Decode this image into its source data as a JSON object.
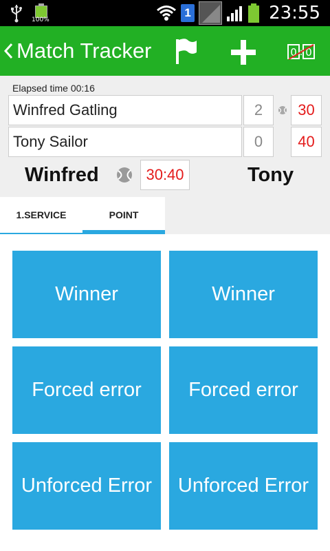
{
  "status_bar": {
    "battery_small_label": "100%",
    "sim_number": "1",
    "time": "23:55"
  },
  "action_bar": {
    "title": "Match Tracker",
    "icons": [
      "back-arrow-icon",
      "flag-icon",
      "plus-icon",
      "score-reset-icon"
    ],
    "score_icon_text": "0:0"
  },
  "match": {
    "elapsed_label": "Elapsed time 00:16",
    "players": [
      {
        "name": "Winfred Gatling",
        "sets": "2",
        "points": "30",
        "serving": true
      },
      {
        "name": "Tony Sailor",
        "sets": "0",
        "points": "40",
        "serving": false
      }
    ],
    "left_short_name": "Winfred",
    "right_short_name": "Tony",
    "game_score": "30:40"
  },
  "tabs": [
    {
      "label": "1.SERVICE",
      "active": false
    },
    {
      "label": "POINT",
      "active": true
    }
  ],
  "buttons": {
    "left": [
      "Winner",
      "Forced error",
      "Unforced Error"
    ],
    "right": [
      "Winner",
      "Forced error",
      "Unforced Error"
    ]
  },
  "colors": {
    "action_bar": "#22b024",
    "button": "#2aa8e0",
    "points": "#e41b1b",
    "tab_indicator": "#2aa8e0"
  }
}
